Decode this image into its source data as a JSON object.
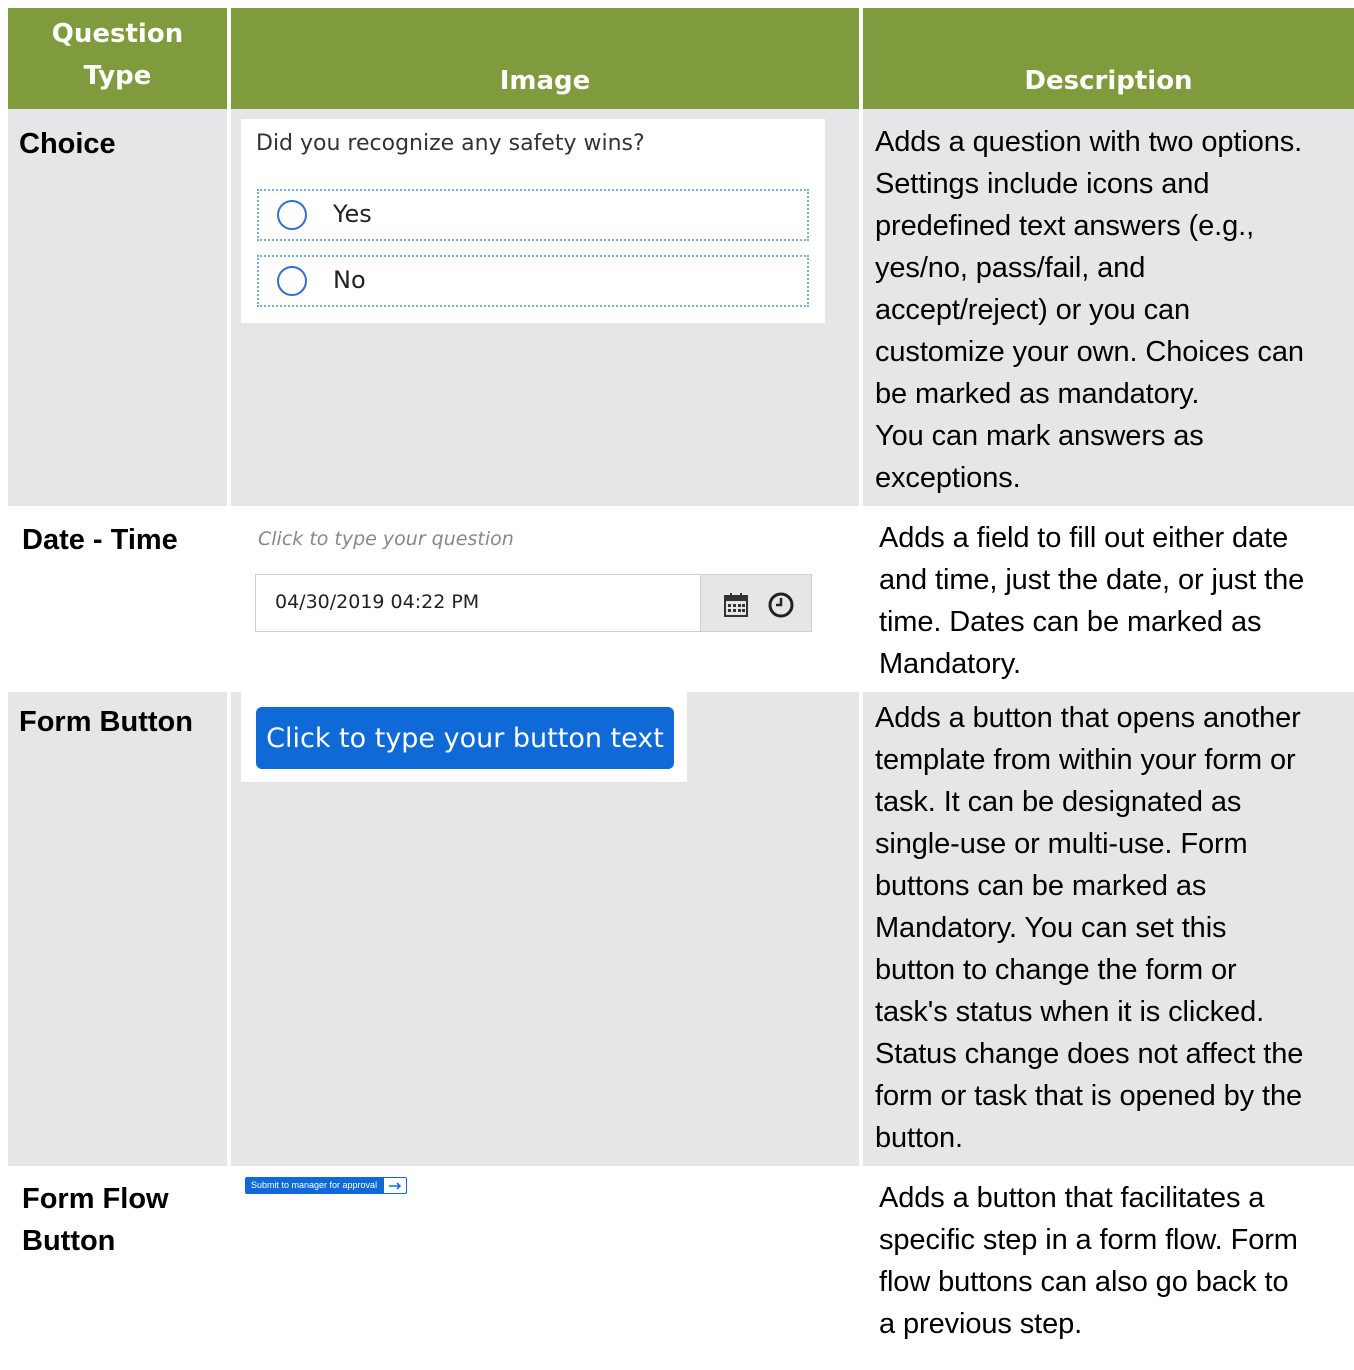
{
  "header": {
    "col1": "Question Type",
    "col1_line1": "Question",
    "col1_line2": "Type",
    "col2": "Image",
    "col3": "Description"
  },
  "rows": [
    {
      "type": "Choice",
      "image": {
        "question": "Did you recognize any safety wins?",
        "options": [
          "Yes",
          "No"
        ]
      },
      "description_lines": [
        "Adds a question with two options.",
        "Settings include icons and",
        "predefined text answers (e.g.,",
        "yes/no, pass/fail, and",
        "accept/reject) or you can",
        "customize your own. Choices can",
        "be marked as mandatory.",
        "You can mark answers as",
        "exceptions."
      ]
    },
    {
      "type": "Date - Time",
      "image": {
        "placeholder": "Click to type your question",
        "value": "04/30/2019 04:22 PM",
        "icons": [
          "calendar-icon",
          "clock-icon"
        ]
      },
      "description_lines": [
        "Adds a field to fill out either date",
        "and time, just the date, or just the",
        "time. Dates can be marked as",
        "Mandatory."
      ]
    },
    {
      "type": "Form Button",
      "image": {
        "button_text": "Click to type your button text"
      },
      "description_lines": [
        "Adds a button that opens another",
        "template from within your form or",
        "task. It can be designated as",
        "single-use or multi-use. Form",
        "buttons can be marked as",
        "Mandatory. You can set this",
        "button to change the form or",
        "task's status when it is clicked.",
        "Status change does not affect the",
        "form or task that is opened by the",
        "button."
      ]
    },
    {
      "type_lines": [
        "Form Flow",
        "Button"
      ],
      "image": {
        "button_text": "Submit to manager for approval",
        "icon": "arrow-right-icon"
      },
      "description_lines": [
        "Adds a button that facilitates a",
        "specific step in a form flow. Form",
        "flow buttons can also go back to",
        "a previous step."
      ]
    }
  ],
  "colors": {
    "header_bg": "#7f9b3d",
    "row_bg": "#e4e6e8",
    "button_blue": "#0f6ad8",
    "radio_blue": "#2f6fd0"
  }
}
